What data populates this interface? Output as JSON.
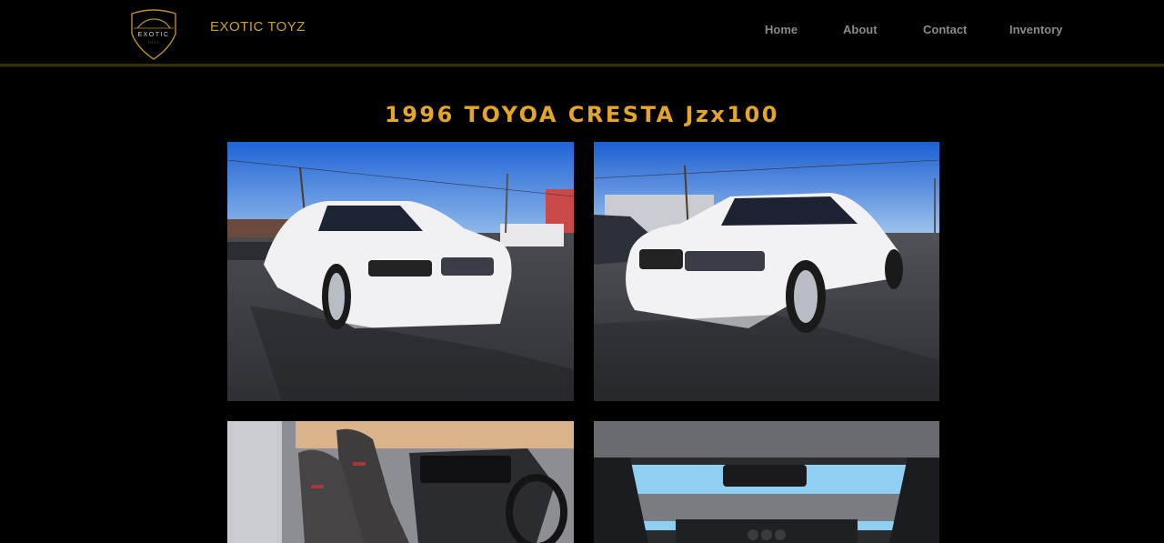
{
  "header": {
    "brand": "EXOTIC TOYZ",
    "logo_text": "EXOTIC",
    "logo_subtext": "TOYZ",
    "nav": [
      {
        "label": "Home"
      },
      {
        "label": "About"
      },
      {
        "label": "Contact"
      },
      {
        "label": "Inventory"
      }
    ]
  },
  "listing": {
    "title": "1996 TOYOA CRESTA Jzx100"
  },
  "gallery": [
    {
      "icon": "car-front-left-photo"
    },
    {
      "icon": "car-front-right-photo"
    },
    {
      "icon": "car-interior-seats-photo"
    },
    {
      "icon": "car-interior-dashboard-photo"
    }
  ],
  "colors": {
    "accent_gold": "#e3a52a",
    "brand_gold": "#c9a227",
    "background": "#000000",
    "nav_text": "#8a8a8a"
  }
}
